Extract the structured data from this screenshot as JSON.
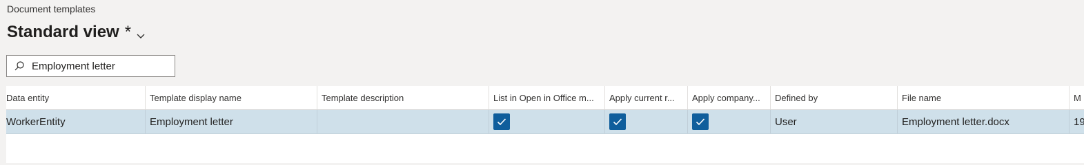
{
  "page": {
    "caption": "Document templates",
    "view_name": "Standard view",
    "modified_marker": "*"
  },
  "search": {
    "value": "Employment letter",
    "icon": "search-icon"
  },
  "grid": {
    "columns": [
      "Data entity",
      "Template display name",
      "Template description",
      "List in Open in Office m...",
      "Apply current r...",
      "Apply company...",
      "Defined by",
      "File name",
      "M"
    ],
    "rows": [
      {
        "data_entity": "WorkerEntity",
        "template_display_name": "Employment letter",
        "template_description": "",
        "list_in_open_in_office": true,
        "apply_current_record": true,
        "apply_company": true,
        "defined_by": "User",
        "file_name": "Employment letter.docx",
        "truncated": "19"
      }
    ]
  },
  "colors": {
    "background": "#f3f2f1",
    "selected_row": "#cfe0ea",
    "checkbox": "#0f5e9c"
  }
}
